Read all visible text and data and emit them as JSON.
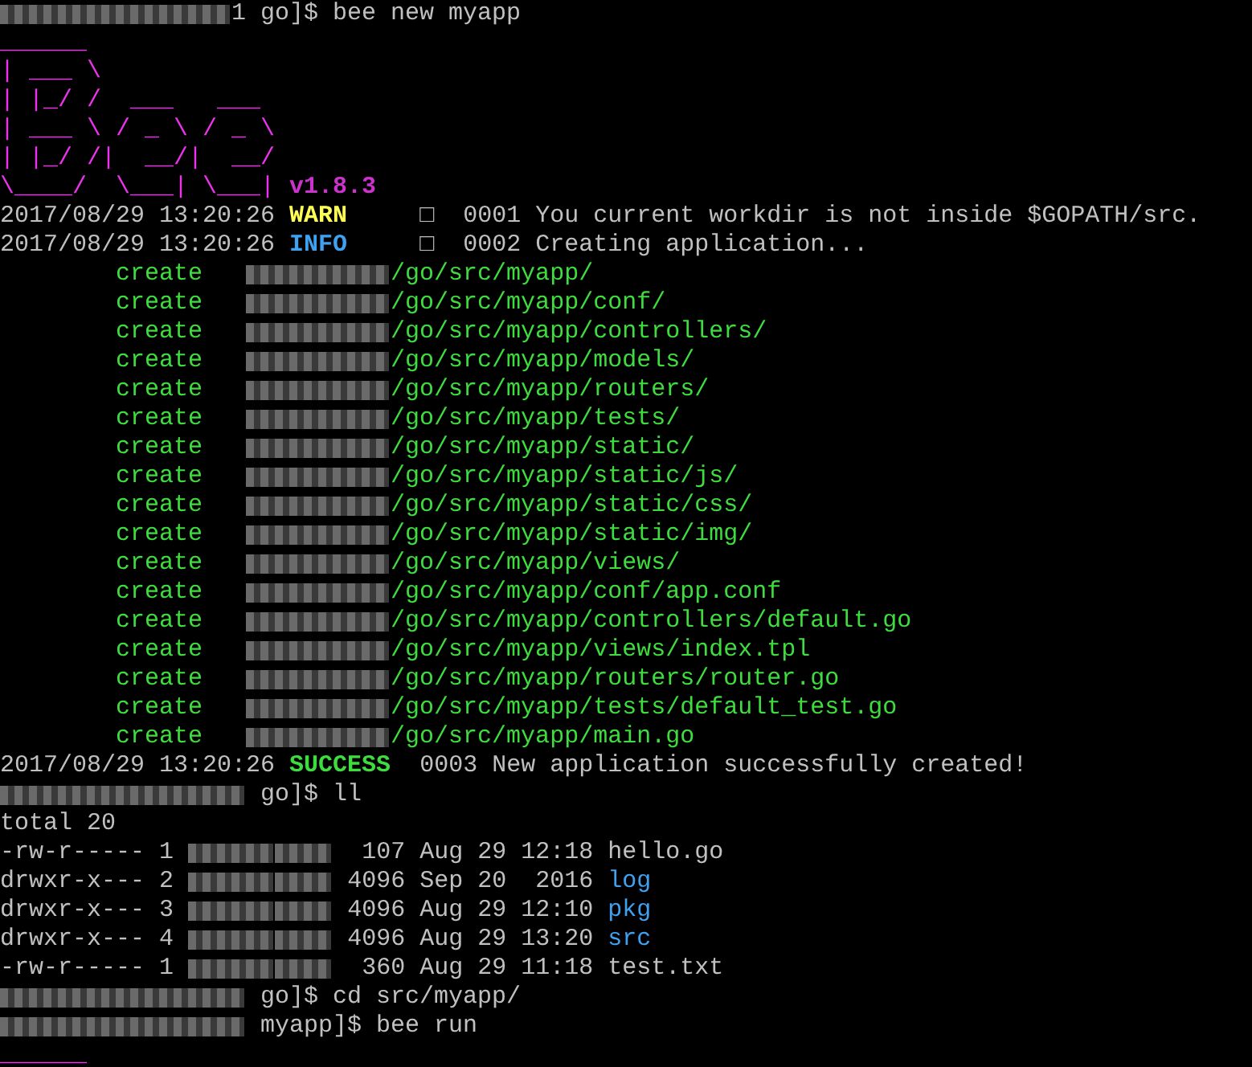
{
  "terminal": {
    "lines": [
      {
        "segments": [
          {
            "kind": "blur-host-short"
          },
          {
            "kind": "plain",
            "text": "1 go]$ bee new myapp"
          }
        ]
      },
      {
        "segments": [
          {
            "kind": "logo",
            "text": "______"
          }
        ]
      },
      {
        "segments": [
          {
            "kind": "logo",
            "text": "| ___ \\"
          }
        ]
      },
      {
        "segments": [
          {
            "kind": "logo",
            "text": "| |_/ /  ___   ___"
          }
        ]
      },
      {
        "segments": [
          {
            "kind": "logo",
            "text": "| ___ \\ / _ \\ / _ \\"
          }
        ]
      },
      {
        "segments": [
          {
            "kind": "logo",
            "text": "| |_/ /|  __/|  __/"
          }
        ]
      },
      {
        "segments": [
          {
            "kind": "logo",
            "text": "\\____/  \\___| \\___|"
          },
          {
            "kind": "version",
            "text": " v1.8.3"
          }
        ]
      },
      {
        "segments": [
          {
            "kind": "plain",
            "text": "2017/08/29 13:20:26 "
          },
          {
            "kind": "warn",
            "text": "WARN"
          },
          {
            "kind": "plain",
            "text": "     □  0001 You current workdir is not inside $GOPATH/src."
          }
        ]
      },
      {
        "segments": [
          {
            "kind": "plain",
            "text": "2017/08/29 13:20:26 "
          },
          {
            "kind": "info",
            "text": "INFO"
          },
          {
            "kind": "plain",
            "text": "     □  0002 Creating application..."
          }
        ]
      },
      {
        "segments": [
          {
            "kind": "green",
            "text": "        create   "
          },
          {
            "kind": "blur-home"
          },
          {
            "kind": "green",
            "text": "/go/src/myapp/"
          }
        ]
      },
      {
        "segments": [
          {
            "kind": "green",
            "text": "        create   "
          },
          {
            "kind": "blur-home"
          },
          {
            "kind": "green",
            "text": "/go/src/myapp/conf/"
          }
        ]
      },
      {
        "segments": [
          {
            "kind": "green",
            "text": "        create   "
          },
          {
            "kind": "blur-home"
          },
          {
            "kind": "green",
            "text": "/go/src/myapp/controllers/"
          }
        ]
      },
      {
        "segments": [
          {
            "kind": "green",
            "text": "        create   "
          },
          {
            "kind": "blur-home"
          },
          {
            "kind": "green",
            "text": "/go/src/myapp/models/"
          }
        ]
      },
      {
        "segments": [
          {
            "kind": "green",
            "text": "        create   "
          },
          {
            "kind": "blur-home"
          },
          {
            "kind": "green",
            "text": "/go/src/myapp/routers/"
          }
        ]
      },
      {
        "segments": [
          {
            "kind": "green",
            "text": "        create   "
          },
          {
            "kind": "blur-home"
          },
          {
            "kind": "green",
            "text": "/go/src/myapp/tests/"
          }
        ]
      },
      {
        "segments": [
          {
            "kind": "green",
            "text": "        create   "
          },
          {
            "kind": "blur-home"
          },
          {
            "kind": "green",
            "text": "/go/src/myapp/static/"
          }
        ]
      },
      {
        "segments": [
          {
            "kind": "green",
            "text": "        create   "
          },
          {
            "kind": "blur-home"
          },
          {
            "kind": "green",
            "text": "/go/src/myapp/static/js/"
          }
        ]
      },
      {
        "segments": [
          {
            "kind": "green",
            "text": "        create   "
          },
          {
            "kind": "blur-home"
          },
          {
            "kind": "green",
            "text": "/go/src/myapp/static/css/"
          }
        ]
      },
      {
        "segments": [
          {
            "kind": "green",
            "text": "        create   "
          },
          {
            "kind": "blur-home"
          },
          {
            "kind": "green",
            "text": "/go/src/myapp/static/img/"
          }
        ]
      },
      {
        "segments": [
          {
            "kind": "green",
            "text": "        create   "
          },
          {
            "kind": "blur-home"
          },
          {
            "kind": "green",
            "text": "/go/src/myapp/views/"
          }
        ]
      },
      {
        "segments": [
          {
            "kind": "green",
            "text": "        create   "
          },
          {
            "kind": "blur-home"
          },
          {
            "kind": "green",
            "text": "/go/src/myapp/conf/app.conf"
          }
        ]
      },
      {
        "segments": [
          {
            "kind": "green",
            "text": "        create   "
          },
          {
            "kind": "blur-home"
          },
          {
            "kind": "green",
            "text": "/go/src/myapp/controllers/default.go"
          }
        ]
      },
      {
        "segments": [
          {
            "kind": "green",
            "text": "        create   "
          },
          {
            "kind": "blur-home"
          },
          {
            "kind": "green",
            "text": "/go/src/myapp/views/index.tpl"
          }
        ]
      },
      {
        "segments": [
          {
            "kind": "green",
            "text": "        create   "
          },
          {
            "kind": "blur-home"
          },
          {
            "kind": "green",
            "text": "/go/src/myapp/routers/router.go"
          }
        ]
      },
      {
        "segments": [
          {
            "kind": "green",
            "text": "        create   "
          },
          {
            "kind": "blur-home"
          },
          {
            "kind": "green",
            "text": "/go/src/myapp/tests/default_test.go"
          }
        ]
      },
      {
        "segments": [
          {
            "kind": "green",
            "text": "        create   "
          },
          {
            "kind": "blur-home"
          },
          {
            "kind": "green",
            "text": "/go/src/myapp/main.go"
          }
        ]
      },
      {
        "segments": [
          {
            "kind": "plain",
            "text": "2017/08/29 13:20:26 "
          },
          {
            "kind": "success",
            "text": "SUCCESS"
          },
          {
            "kind": "plain",
            "text": "  0003 New application successfully created!"
          }
        ]
      },
      {
        "segments": [
          {
            "kind": "blur-host"
          },
          {
            "kind": "plain",
            "text": " go]$ ll"
          }
        ]
      },
      {
        "segments": [
          {
            "kind": "plain",
            "text": "total 20"
          }
        ]
      },
      {
        "segments": [
          {
            "kind": "plain",
            "text": "-rw-r----- 1 "
          },
          {
            "kind": "blur-user"
          },
          {
            "kind": "blur-group"
          },
          {
            "kind": "plain",
            "text": "  107 Aug 29 12:18 hello.go"
          }
        ]
      },
      {
        "segments": [
          {
            "kind": "plain",
            "text": "drwxr-x--- 2 "
          },
          {
            "kind": "blur-user"
          },
          {
            "kind": "blur-group"
          },
          {
            "kind": "plain",
            "text": " 4096 Sep 20  2016 "
          },
          {
            "kind": "dir",
            "text": "log"
          }
        ]
      },
      {
        "segments": [
          {
            "kind": "plain",
            "text": "drwxr-x--- 3 "
          },
          {
            "kind": "blur-user"
          },
          {
            "kind": "blur-group"
          },
          {
            "kind": "plain",
            "text": " 4096 Aug 29 12:10 "
          },
          {
            "kind": "dir",
            "text": "pkg"
          }
        ]
      },
      {
        "segments": [
          {
            "kind": "plain",
            "text": "drwxr-x--- 4 "
          },
          {
            "kind": "blur-user"
          },
          {
            "kind": "blur-group"
          },
          {
            "kind": "plain",
            "text": " 4096 Aug 29 13:20 "
          },
          {
            "kind": "dir",
            "text": "src"
          }
        ]
      },
      {
        "segments": [
          {
            "kind": "plain",
            "text": "-rw-r----- 1 "
          },
          {
            "kind": "blur-user"
          },
          {
            "kind": "blur-group"
          },
          {
            "kind": "plain",
            "text": "  360 Aug 29 11:18 test.txt"
          }
        ]
      },
      {
        "segments": [
          {
            "kind": "blur-host"
          },
          {
            "kind": "plain",
            "text": " go]$ cd src/myapp/"
          }
        ]
      },
      {
        "segments": [
          {
            "kind": "blur-host"
          },
          {
            "kind": "plain",
            "text": " myapp]$ bee run"
          }
        ]
      },
      {
        "segments": [
          {
            "kind": "logo",
            "text": "______"
          }
        ]
      }
    ]
  }
}
